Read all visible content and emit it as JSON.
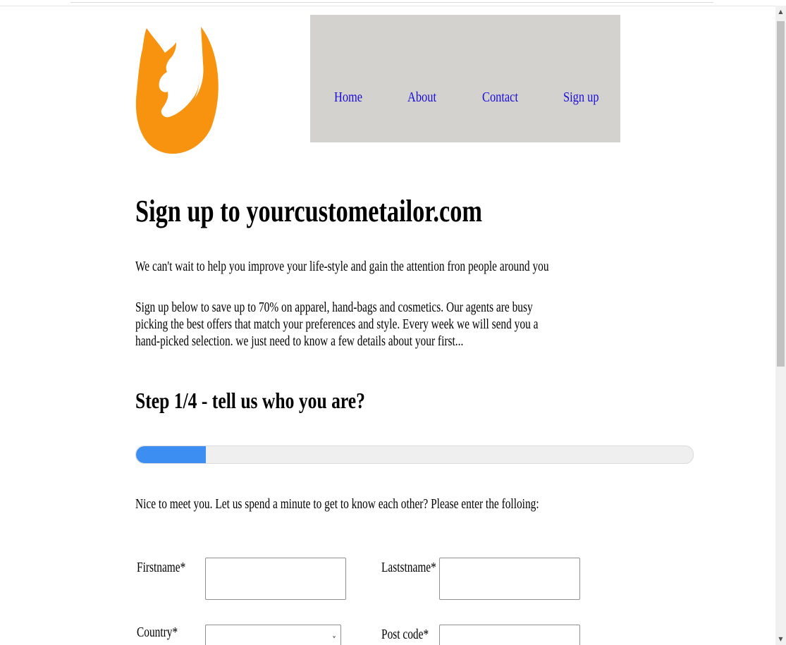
{
  "nav": {
    "home": "Home",
    "about": "About",
    "contact": "Contact",
    "signup": "Sign up",
    "background": "#d3d2cf",
    "link_color": "#1a0dd9"
  },
  "logo": {
    "icon": "fox-logo-icon",
    "color": "#f7930e"
  },
  "main": {
    "title": "Sign up to yourcustometailor.com",
    "intro1": "We can't wait to help you improve your life-style and gain the attention fron people around you",
    "intro2": "Sign up below to save up to 70% on apparel, hand-bags and cosmetics. Our agents are busy picking the best offers that match your preferences and style. Every week we will send you a hand-picked selection. we just need to know a few details about your first...",
    "step_title": "Step 1/4 - tell us who you are?",
    "progress": {
      "fraction": 0.125,
      "color": "#3c8ef3"
    },
    "nice": "Nice to meet you. Let us spend a minute to get to know each other? Please enter the folloing:"
  },
  "form": {
    "firstname_label": "Firstname*",
    "firstname_value": "",
    "lastname_label": "Laststname*",
    "lastname_value": "",
    "country_label": "Country*",
    "country_selected": "",
    "postcode_label": "Post code*",
    "postcode_value": ""
  },
  "scrollbar": {
    "up_icon": "scroll-up-arrow-icon",
    "down_icon": "scroll-down-arrow-icon"
  }
}
